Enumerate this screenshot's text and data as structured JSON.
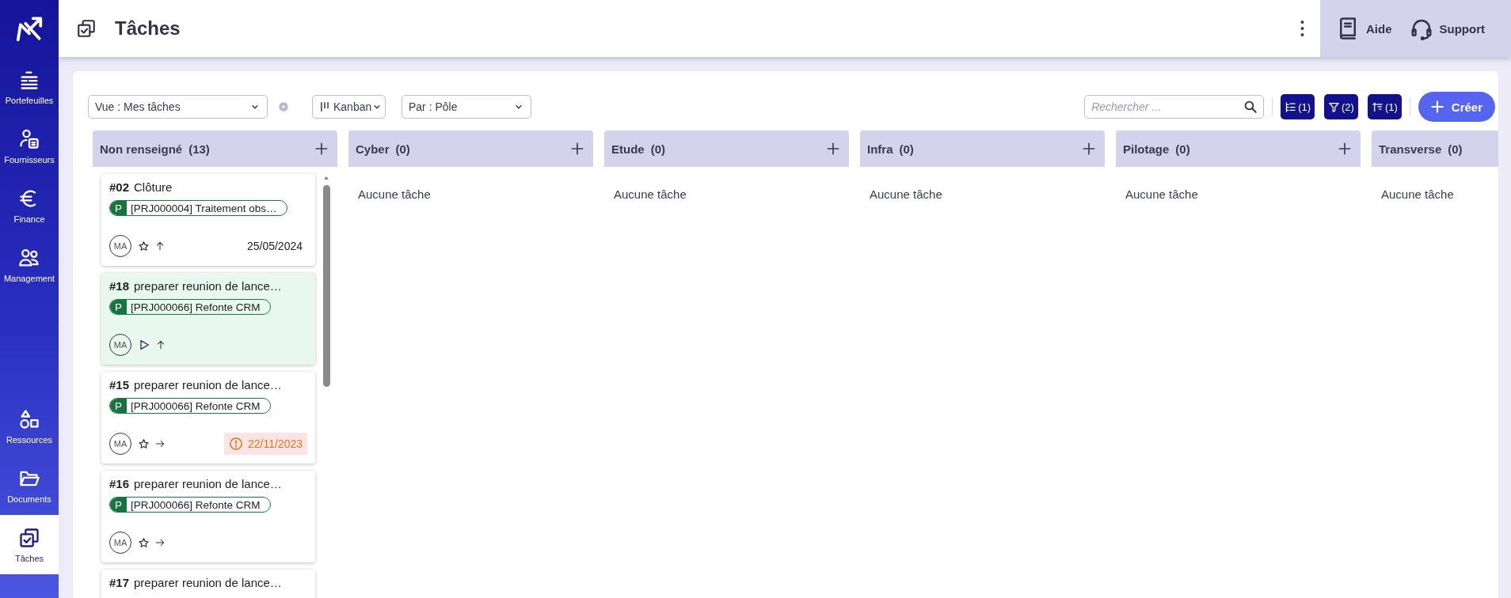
{
  "sidebar": {
    "items": [
      {
        "label": "Portefeuilles",
        "kind": "bars",
        "selected": false
      },
      {
        "label": "Fournisseurs",
        "kind": "supplier",
        "selected": false
      },
      {
        "label": "Finance",
        "kind": "euro",
        "selected": false
      },
      {
        "label": "Management",
        "kind": "people",
        "selected": false
      }
    ],
    "bottom_items": [
      {
        "label": "Ressources",
        "kind": "shapes",
        "selected": false
      },
      {
        "label": "Documents",
        "kind": "folder",
        "selected": false
      },
      {
        "label": "Tâches",
        "kind": "tasks",
        "selected": true
      }
    ]
  },
  "topbar": {
    "title": "Tâches",
    "links": [
      {
        "label": "Aide",
        "kind": "book"
      },
      {
        "label": "Support",
        "kind": "headset"
      }
    ]
  },
  "toolbar": {
    "view_select": {
      "value": "Vue : Mes tâches"
    },
    "display_select": {
      "value": "Kanban"
    },
    "group_select": {
      "value": "Par : Pôle"
    },
    "search": {
      "placeholder": "Rechercher ..."
    },
    "filter_buttons": [
      {
        "kind": "tree",
        "label": "(1)"
      },
      {
        "kind": "filter",
        "label": "(2)"
      },
      {
        "kind": "sort",
        "label": "(1)"
      }
    ],
    "create_button": {
      "label": "Créer"
    }
  },
  "columns": [
    {
      "name": "Non renseigné",
      "count": "(13)",
      "can_add": true,
      "cards": [
        {
          "number": "#02",
          "title": "Clôture",
          "project_tag": "P",
          "project": "[PRJ000004] Traitement obs…",
          "assignee": "MA",
          "started": false,
          "high_priority": true,
          "due_date": "25/05/2024",
          "overdue": false,
          "selected": false
        },
        {
          "number": "#18",
          "title": "preparer reunion de lance…",
          "project_tag": "P",
          "project": "[PRJ000066] Refonte CRM",
          "assignee": "MA",
          "started": true,
          "high_priority": true,
          "selected": true
        },
        {
          "number": "#15",
          "title": "preparer reunion de lance…",
          "project_tag": "P",
          "project": "[PRJ000066] Refonte CRM",
          "assignee": "MA",
          "started": false,
          "high_priority": false,
          "due_date": "22/11/2023",
          "overdue": true,
          "selected": false
        },
        {
          "number": "#16",
          "title": "preparer reunion de lance…",
          "project_tag": "P",
          "project": "[PRJ000066] Refonte CRM",
          "assignee": "MA",
          "started": false,
          "high_priority": false,
          "selected": false
        },
        {
          "number": "#17",
          "title": "preparer reunion de lance…",
          "selected": false
        }
      ]
    },
    {
      "name": "Cyber",
      "count": "(0)",
      "can_add": true,
      "empty_text": "Aucune tâche"
    },
    {
      "name": "Etude",
      "count": "(0)",
      "can_add": true,
      "empty_text": "Aucune tâche"
    },
    {
      "name": "Infra",
      "count": "(0)",
      "can_add": true,
      "empty_text": "Aucune tâche"
    },
    {
      "name": "Pilotage",
      "count": "(0)",
      "can_add": true,
      "empty_text": "Aucune tâche"
    },
    {
      "name": "Transverse",
      "count": "(0)",
      "can_add": false,
      "empty_text": "Aucune tâche"
    }
  ]
}
